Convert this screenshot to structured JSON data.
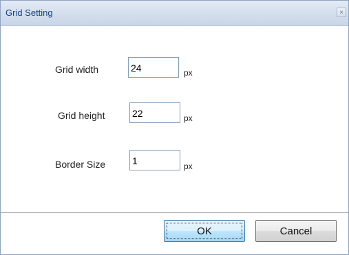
{
  "dialog": {
    "title": "Grid Setting",
    "close_glyph": "×"
  },
  "fields": {
    "grid_width": {
      "label": "Grid width",
      "value": "24",
      "unit": "px"
    },
    "grid_height": {
      "label": "Grid height",
      "value": "22",
      "unit": "px"
    },
    "border_size": {
      "label": "Border Size",
      "value": "1",
      "unit": "px"
    }
  },
  "buttons": {
    "ok_label": "OK",
    "cancel_label": "Cancel"
  },
  "icons": {
    "close": "close-icon"
  }
}
